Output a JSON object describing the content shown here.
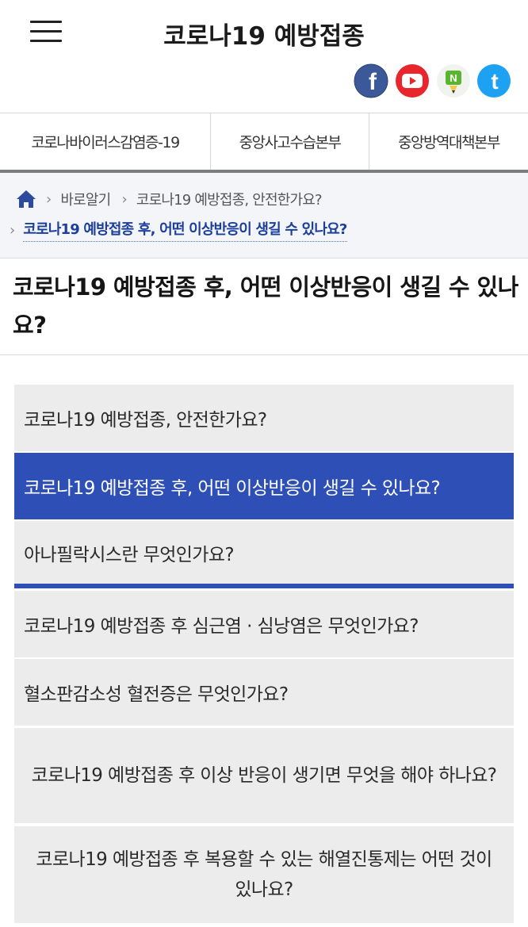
{
  "header": {
    "title": "코로나19 예방접종",
    "social": [
      {
        "name": "facebook",
        "icon": "facebook-icon",
        "glyph": "f",
        "color": "#3b5998"
      },
      {
        "name": "youtube",
        "icon": "youtube-icon",
        "glyph": "▶",
        "color": "#e8262b"
      },
      {
        "name": "blog",
        "icon": "blog-icon",
        "glyph": "N",
        "color": "#5cb531"
      },
      {
        "name": "twitter",
        "icon": "twitter-icon",
        "glyph": "t",
        "color": "#1da1f2"
      }
    ]
  },
  "tabs": [
    {
      "label": "코로나바이러스감염증-19"
    },
    {
      "label": "중앙사고수습본부"
    },
    {
      "label": "중앙방역대책본부"
    }
  ],
  "breadcrumb": {
    "items": [
      "바로알기",
      "코로나19 예방접종, 안전한가요?"
    ],
    "current": "코로나19 예방접종 후, 어떤 이상반응이 생길 수 있나요?"
  },
  "page": {
    "title": "코로나19 예방접종 후, 어떤 이상반응이 생길 수 있나요?"
  },
  "questions": [
    {
      "label": "코로나19 예방접종, 안전한가요?"
    },
    {
      "label": "코로나19 예방접종 후, 어떤 이상반응이 생길 수 있나요?"
    },
    {
      "label": "아나필락시스란 무엇인가요?"
    },
    {
      "label": "코로나19 예방접종 후 심근염 · 심낭염은 무엇인가요?"
    },
    {
      "label": "혈소판감소성 혈전증은 무엇인가요?"
    },
    {
      "label": "코로나19 예방접종 후 이상 반응이 생기면 무엇을 해야 하나요?"
    },
    {
      "label": "코로나19 예방접종 후 복용할 수 있는 해열진통제는 어떤 것이 있나요?"
    }
  ],
  "colors": {
    "accent": "#2e4fb6",
    "breadcrumb_current": "#1c3f9b",
    "item_bg": "#ececec"
  }
}
